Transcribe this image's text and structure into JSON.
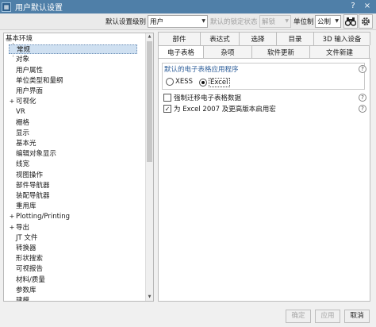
{
  "window": {
    "title": "用户默认设置"
  },
  "title_buttons": {
    "help": "?",
    "close": "×"
  },
  "toolbar": {
    "level_label": "默认设置级别",
    "level_value": "用户",
    "lock_label": "默认的锁定状态",
    "lock_value": "解锁",
    "unit_label": "单位制",
    "unit_value": "公制"
  },
  "tree": {
    "items": [
      {
        "label": "基本环境",
        "toggle": ""
      },
      {
        "label": "常规",
        "toggle": ""
      },
      {
        "label": "对象",
        "toggle": ""
      },
      {
        "label": "用户属性",
        "toggle": ""
      },
      {
        "label": "单位类型和量纲",
        "toggle": ""
      },
      {
        "label": "用户界面",
        "toggle": ""
      },
      {
        "label": "可视化",
        "toggle": "+"
      },
      {
        "label": "VR",
        "toggle": ""
      },
      {
        "label": "栅格",
        "toggle": ""
      },
      {
        "label": "显示",
        "toggle": ""
      },
      {
        "label": "基本光",
        "toggle": ""
      },
      {
        "label": "编辑对象显示",
        "toggle": ""
      },
      {
        "label": "线宽",
        "toggle": ""
      },
      {
        "label": "视图操作",
        "toggle": ""
      },
      {
        "label": "部件导航器",
        "toggle": ""
      },
      {
        "label": "装配导航器",
        "toggle": ""
      },
      {
        "label": "重用库",
        "toggle": ""
      },
      {
        "label": "Plotting/Printing",
        "toggle": "+"
      },
      {
        "label": "导出",
        "toggle": "+"
      },
      {
        "label": "JT 文件",
        "toggle": ""
      },
      {
        "label": "转换器",
        "toggle": ""
      },
      {
        "label": "形状搜索",
        "toggle": ""
      },
      {
        "label": "可视报告",
        "toggle": ""
      },
      {
        "label": "材料/质量",
        "toggle": ""
      },
      {
        "label": "参数库",
        "toggle": ""
      },
      {
        "label": "建模",
        "toggle": ""
      }
    ]
  },
  "tabs_top": [
    "部件",
    "表达式",
    "选择",
    "目录",
    "3D 输入设备"
  ],
  "tabs_bottom": [
    "电子表格",
    "杂项",
    "软件更新",
    "文件新建"
  ],
  "panel": {
    "group_title": "默认的电子表格应用程序",
    "radio_xess": "XESS",
    "radio_excel": "Excel",
    "check_force": "强制迁移电子表格数据",
    "check_excel2007": "为 Excel 2007 及更高版本启用宏",
    "help": "?"
  },
  "footer": {
    "ok": "确定",
    "apply": "应用",
    "cancel": "取消"
  }
}
